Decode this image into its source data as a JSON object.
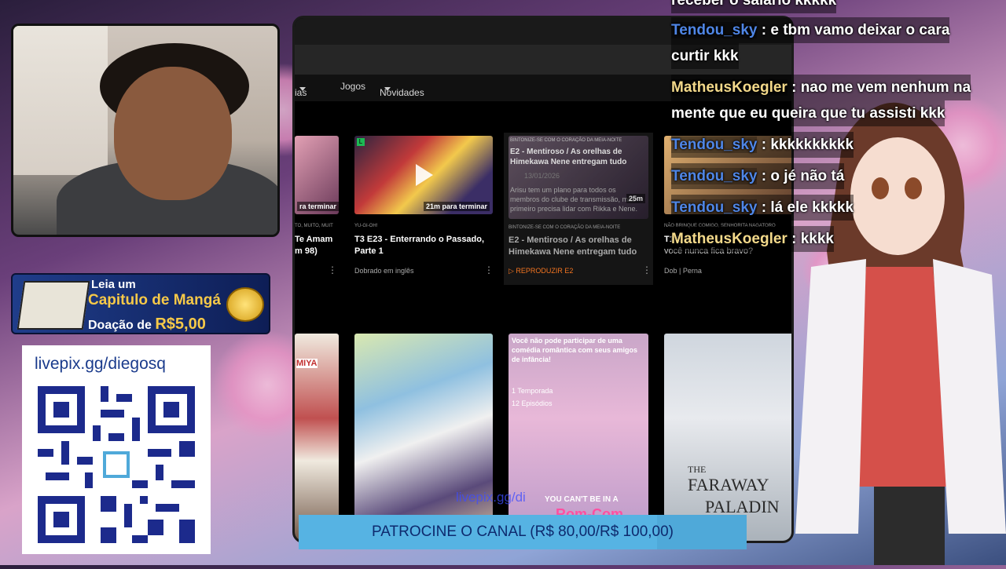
{
  "stream": {
    "manga_panel": {
      "line1": "Leia um",
      "line2": "Capitulo de Mangá",
      "line3_prefix": "Doação de ",
      "line3_amount": "R$5,00"
    },
    "qr_panel": {
      "url": "livepix.gg/diegosq"
    },
    "overlay_url": "livepix.gg/di",
    "banner": {
      "text": "PATROCINE O CANAL (R$ 80,00/R$ 100,00)",
      "progress": 0.8
    }
  },
  "browser": {
    "nav": {
      "partial_item": "ias",
      "jogos": "Jogos",
      "novidades": "Novidades"
    },
    "row1": [
      {
        "badge": "ra terminar",
        "title": "Te Amam",
        "title2": "m 98)",
        "label_small": "TO, MUITO, MUIT"
      },
      {
        "badge": "21m para terminar",
        "label_small": "YU-GI-OH!",
        "title": "T3 E23 - Enterrando o Passado,",
        "title2": "Parte 1",
        "sub": "Dobrado em inglês"
      },
      {
        "hover_label": "BINTONIZE-SE COM O CORAÇÃO DA MEIA-NOITE",
        "hover_title": "E2 - Mentiroso / As orelhas de",
        "hover_title2": "Himekawa Nene entregam tudo",
        "hover_date": "13/01/2026",
        "hover_desc": "Arisu tem um plano para todos os",
        "hover_desc2": "membros do clube de transmissão, mas",
        "hover_desc3": "primeiro precisa lidar com Rikka e Nene.",
        "label_small": "BINTONIZE-SE COM O CORAÇÃO DA MEIA-NOITE",
        "title": "E2 - Mentiroso / As orelhas de",
        "title2": "Himekawa Nene entregam tudo",
        "action": "REPRODUZIR E2",
        "time": "25m"
      },
      {
        "label_small": "NÃO BRINQUE COMIGO, SENHORITA NAGATORO",
        "title": "T1 E",
        "title2": "você nunca fica bravo?",
        "sub": "Dob | Perna"
      }
    ],
    "row2": [
      {
        "text": "MIYA"
      },
      {
        "text": ""
      },
      {
        "hover_desc": "Você não pode participar de uma",
        "hover_desc2": "comédia romântica com seus amigos",
        "hover_desc3": "de infância!",
        "seasons": "1 Temporada",
        "episodes": "12 Episódios",
        "logo_line1": "YOU CAN'T BE IN A",
        "logo_line2": "Rom-Com"
      },
      {
        "logo_line1": "THE",
        "logo_line2": "FARAWAY",
        "logo_line3": "PALADIN"
      }
    ]
  },
  "chat": {
    "messages": [
      {
        "user": "",
        "text": "receber o salário kkkkk"
      },
      {
        "user": "Tendou_sky",
        "text": ": e tbm vamo deixar o cara",
        "cont": "curtir kkk"
      },
      {
        "user": "MatheusKoegler",
        "text": ": nao me vem nenhum na",
        "cont": "mente que eu queira que tu assisti kkk"
      },
      {
        "user": "Tendou_sky",
        "text": ": kkkkkkkkkk"
      },
      {
        "user": "Tendou_sky",
        "text": ": o jé não tá"
      },
      {
        "user": "Tendou_sky",
        "text": ": lá ele kkkkk"
      },
      {
        "user": "MatheusKoegler",
        "text": ": kkkk"
      }
    ]
  },
  "colors": {
    "chat_user_a": "#4f86e6",
    "chat_user_b": "#f3d98a",
    "banner": "#4fa9d9",
    "banner_text": "#0e2a6e"
  }
}
